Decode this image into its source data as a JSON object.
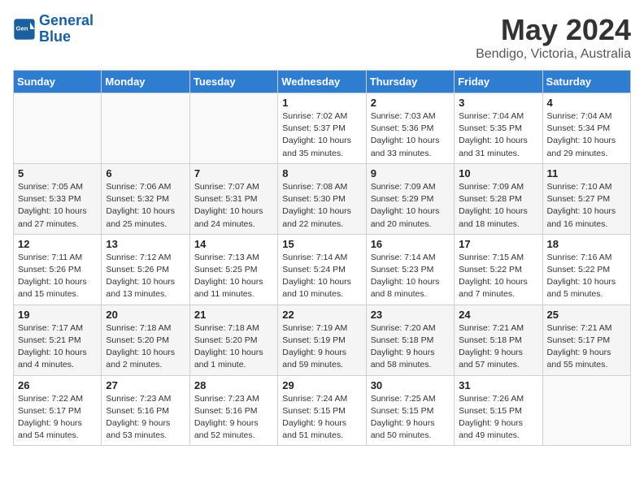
{
  "logo": {
    "line1": "General",
    "line2": "Blue"
  },
  "title": "May 2024",
  "subtitle": "Bendigo, Victoria, Australia",
  "days_header": [
    "Sunday",
    "Monday",
    "Tuesday",
    "Wednesday",
    "Thursday",
    "Friday",
    "Saturday"
  ],
  "weeks": [
    [
      {
        "day": "",
        "info": ""
      },
      {
        "day": "",
        "info": ""
      },
      {
        "day": "",
        "info": ""
      },
      {
        "day": "1",
        "info": "Sunrise: 7:02 AM\nSunset: 5:37 PM\nDaylight: 10 hours\nand 35 minutes."
      },
      {
        "day": "2",
        "info": "Sunrise: 7:03 AM\nSunset: 5:36 PM\nDaylight: 10 hours\nand 33 minutes."
      },
      {
        "day": "3",
        "info": "Sunrise: 7:04 AM\nSunset: 5:35 PM\nDaylight: 10 hours\nand 31 minutes."
      },
      {
        "day": "4",
        "info": "Sunrise: 7:04 AM\nSunset: 5:34 PM\nDaylight: 10 hours\nand 29 minutes."
      }
    ],
    [
      {
        "day": "5",
        "info": "Sunrise: 7:05 AM\nSunset: 5:33 PM\nDaylight: 10 hours\nand 27 minutes."
      },
      {
        "day": "6",
        "info": "Sunrise: 7:06 AM\nSunset: 5:32 PM\nDaylight: 10 hours\nand 25 minutes."
      },
      {
        "day": "7",
        "info": "Sunrise: 7:07 AM\nSunset: 5:31 PM\nDaylight: 10 hours\nand 24 minutes."
      },
      {
        "day": "8",
        "info": "Sunrise: 7:08 AM\nSunset: 5:30 PM\nDaylight: 10 hours\nand 22 minutes."
      },
      {
        "day": "9",
        "info": "Sunrise: 7:09 AM\nSunset: 5:29 PM\nDaylight: 10 hours\nand 20 minutes."
      },
      {
        "day": "10",
        "info": "Sunrise: 7:09 AM\nSunset: 5:28 PM\nDaylight: 10 hours\nand 18 minutes."
      },
      {
        "day": "11",
        "info": "Sunrise: 7:10 AM\nSunset: 5:27 PM\nDaylight: 10 hours\nand 16 minutes."
      }
    ],
    [
      {
        "day": "12",
        "info": "Sunrise: 7:11 AM\nSunset: 5:26 PM\nDaylight: 10 hours\nand 15 minutes."
      },
      {
        "day": "13",
        "info": "Sunrise: 7:12 AM\nSunset: 5:26 PM\nDaylight: 10 hours\nand 13 minutes."
      },
      {
        "day": "14",
        "info": "Sunrise: 7:13 AM\nSunset: 5:25 PM\nDaylight: 10 hours\nand 11 minutes."
      },
      {
        "day": "15",
        "info": "Sunrise: 7:14 AM\nSunset: 5:24 PM\nDaylight: 10 hours\nand 10 minutes."
      },
      {
        "day": "16",
        "info": "Sunrise: 7:14 AM\nSunset: 5:23 PM\nDaylight: 10 hours\nand 8 minutes."
      },
      {
        "day": "17",
        "info": "Sunrise: 7:15 AM\nSunset: 5:22 PM\nDaylight: 10 hours\nand 7 minutes."
      },
      {
        "day": "18",
        "info": "Sunrise: 7:16 AM\nSunset: 5:22 PM\nDaylight: 10 hours\nand 5 minutes."
      }
    ],
    [
      {
        "day": "19",
        "info": "Sunrise: 7:17 AM\nSunset: 5:21 PM\nDaylight: 10 hours\nand 4 minutes."
      },
      {
        "day": "20",
        "info": "Sunrise: 7:18 AM\nSunset: 5:20 PM\nDaylight: 10 hours\nand 2 minutes."
      },
      {
        "day": "21",
        "info": "Sunrise: 7:18 AM\nSunset: 5:20 PM\nDaylight: 10 hours\nand 1 minute."
      },
      {
        "day": "22",
        "info": "Sunrise: 7:19 AM\nSunset: 5:19 PM\nDaylight: 9 hours\nand 59 minutes."
      },
      {
        "day": "23",
        "info": "Sunrise: 7:20 AM\nSunset: 5:18 PM\nDaylight: 9 hours\nand 58 minutes."
      },
      {
        "day": "24",
        "info": "Sunrise: 7:21 AM\nSunset: 5:18 PM\nDaylight: 9 hours\nand 57 minutes."
      },
      {
        "day": "25",
        "info": "Sunrise: 7:21 AM\nSunset: 5:17 PM\nDaylight: 9 hours\nand 55 minutes."
      }
    ],
    [
      {
        "day": "26",
        "info": "Sunrise: 7:22 AM\nSunset: 5:17 PM\nDaylight: 9 hours\nand 54 minutes."
      },
      {
        "day": "27",
        "info": "Sunrise: 7:23 AM\nSunset: 5:16 PM\nDaylight: 9 hours\nand 53 minutes."
      },
      {
        "day": "28",
        "info": "Sunrise: 7:23 AM\nSunset: 5:16 PM\nDaylight: 9 hours\nand 52 minutes."
      },
      {
        "day": "29",
        "info": "Sunrise: 7:24 AM\nSunset: 5:15 PM\nDaylight: 9 hours\nand 51 minutes."
      },
      {
        "day": "30",
        "info": "Sunrise: 7:25 AM\nSunset: 5:15 PM\nDaylight: 9 hours\nand 50 minutes."
      },
      {
        "day": "31",
        "info": "Sunrise: 7:26 AM\nSunset: 5:15 PM\nDaylight: 9 hours\nand 49 minutes."
      },
      {
        "day": "",
        "info": ""
      }
    ]
  ]
}
